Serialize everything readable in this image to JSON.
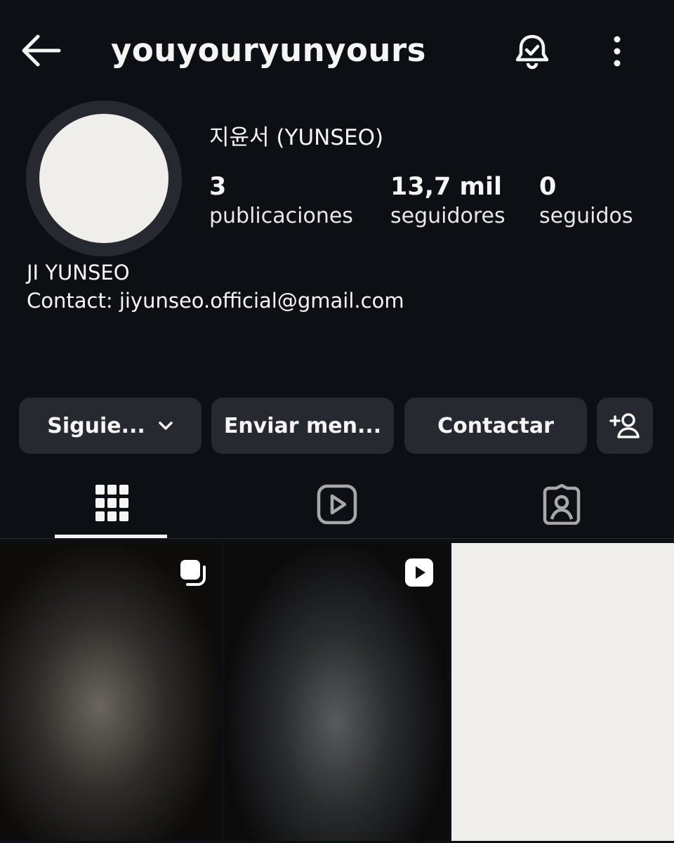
{
  "header": {
    "username": "youyouryunyours",
    "back_icon": "arrow-left-icon",
    "bell_icon": "bell-check-icon",
    "more_icon": "more-vertical-icon"
  },
  "profile": {
    "full_name": "지윤서 (YUNSEO)",
    "stats": [
      {
        "value": "3",
        "label": "publicaciones"
      },
      {
        "value": "13,7 mil",
        "label": "seguidores"
      },
      {
        "value": "0",
        "label": "seguidos"
      }
    ],
    "bio_line1": "JI YUNSEO",
    "bio_line2": "Contact: jiyunseo.official@gmail.com"
  },
  "actions": {
    "follow_label": "Siguie...",
    "message_label": "Enviar men...",
    "contact_label": "Contactar",
    "add_user_icon": "add-user-icon"
  },
  "tabs": [
    {
      "icon": "grid-icon",
      "selected": true
    },
    {
      "icon": "reels-icon",
      "selected": false
    },
    {
      "icon": "tagged-icon",
      "selected": false
    }
  ],
  "posts": [
    {
      "type": "carousel",
      "badge_icon": "carousel-icon"
    },
    {
      "type": "video",
      "badge_icon": "play-icon"
    },
    {
      "type": "image"
    }
  ],
  "colors": {
    "background": "#0c1014",
    "button_bg": "#262a30",
    "text": "#f5f5f5",
    "avatar": "#efeeeb"
  }
}
